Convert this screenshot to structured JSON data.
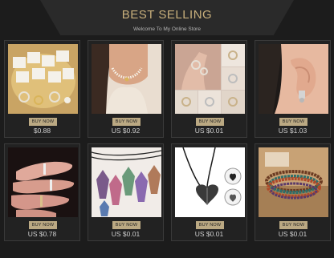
{
  "header": {
    "title": "BEST SELLING",
    "subtitle": "Welcome To My Online Store"
  },
  "products": [
    {
      "image": "earring-set-photo",
      "buy_label": "BUY NOW",
      "price": "$0.88"
    },
    {
      "image": "pearl-necklace-photo",
      "buy_label": "BUY NOW",
      "price": "US $0.92"
    },
    {
      "image": "ring-collage-photo",
      "buy_label": "BUY NOW",
      "price": "US $0.01"
    },
    {
      "image": "ear-cuff-photo",
      "buy_label": "BUY NOW",
      "price": "US $1.03"
    },
    {
      "image": "hand-rings-photo",
      "buy_label": "BUY NOW",
      "price": "US $0.78"
    },
    {
      "image": "crystal-pendants-photo",
      "buy_label": "BUY NOW",
      "price": "US $0.01"
    },
    {
      "image": "heart-magnet-necklace-photo",
      "buy_label": "BUY NOW",
      "price": "US $0.01"
    },
    {
      "image": "beaded-bracelets-photo",
      "buy_label": "BUY NOW",
      "price": "US $0.01"
    }
  ],
  "colors": {
    "accent_gold": "#c9b07c",
    "button_bg": "#bba983",
    "background": "#1c1c1c"
  }
}
